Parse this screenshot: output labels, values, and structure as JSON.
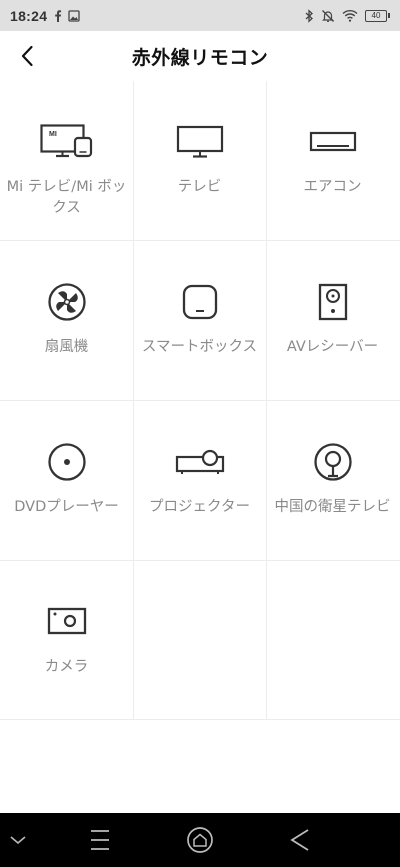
{
  "status": {
    "time": "18:24",
    "battery": "40",
    "left_icons": [
      "facebook-icon",
      "image-icon"
    ],
    "right_icons": [
      "bluetooth-icon",
      "mute-icon",
      "wifi-icon",
      "battery-icon"
    ]
  },
  "header": {
    "title": "赤外線リモコン",
    "back_icon": "chevron-left-icon"
  },
  "devices": [
    {
      "label": "Mi テレビ/Mi ボックス",
      "icon": "mi-tv-box-icon"
    },
    {
      "label": "テレビ",
      "icon": "tv-icon"
    },
    {
      "label": "エアコン",
      "icon": "air-conditioner-icon"
    },
    {
      "label": "扇風機",
      "icon": "fan-icon"
    },
    {
      "label": "スマートボックス",
      "icon": "smart-box-icon"
    },
    {
      "label": "AVレシーバー",
      "icon": "speaker-icon"
    },
    {
      "label": "DVDプレーヤー",
      "icon": "disc-icon"
    },
    {
      "label": "プロジェクター",
      "icon": "projector-icon"
    },
    {
      "label": "中国の衛星テレビ",
      "icon": "satellite-icon"
    },
    {
      "label": "カメラ",
      "icon": "camera-icon"
    }
  ],
  "nav": [
    "chevron-down-icon",
    "menu-icon",
    "home-icon",
    "back-icon"
  ]
}
